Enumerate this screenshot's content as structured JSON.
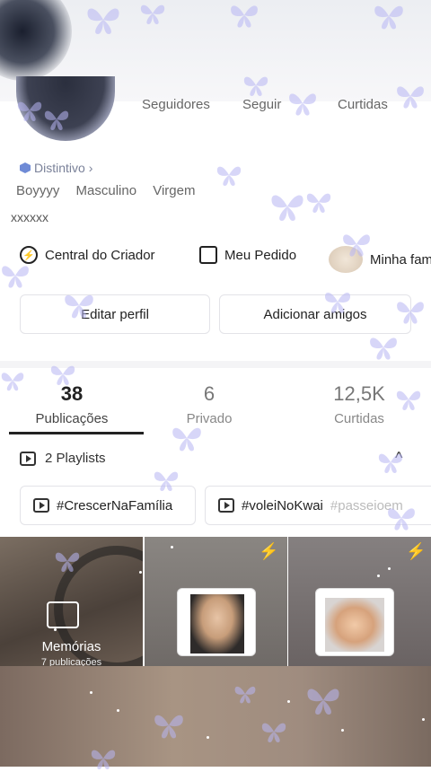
{
  "profile": {
    "stats": {
      "followers": "Seguidores",
      "following": "Seguir",
      "likes": "Curtidas"
    },
    "badge": "Distintivo",
    "badge_chevron": "›",
    "username": "Boyyyy",
    "gender": "Masculino",
    "sign": "Virgem",
    "bio": "xxxxxx"
  },
  "shortcuts": {
    "creator": "Central do Criador",
    "orders": "Meu Pedido",
    "family": "Minha fam"
  },
  "buttons": {
    "edit": "Editar perfil",
    "add_friends": "Adicionar amigos"
  },
  "tabs": [
    {
      "num": "38",
      "label": "Publicações"
    },
    {
      "num": "6",
      "label": "Privado"
    },
    {
      "num": "12,5K",
      "label": "Curtidas"
    }
  ],
  "playlists": {
    "label": "2 Playlists",
    "chevron": "^"
  },
  "chips": [
    "#CrescerNaFamília",
    "#voleiNoKwai",
    "#passeioem"
  ],
  "grid": {
    "memories_title": "Memórias",
    "memories_sub": "7 publicações"
  },
  "colors": {
    "accent": "#6f8bd6",
    "butterfly": "#b8b6f4"
  }
}
